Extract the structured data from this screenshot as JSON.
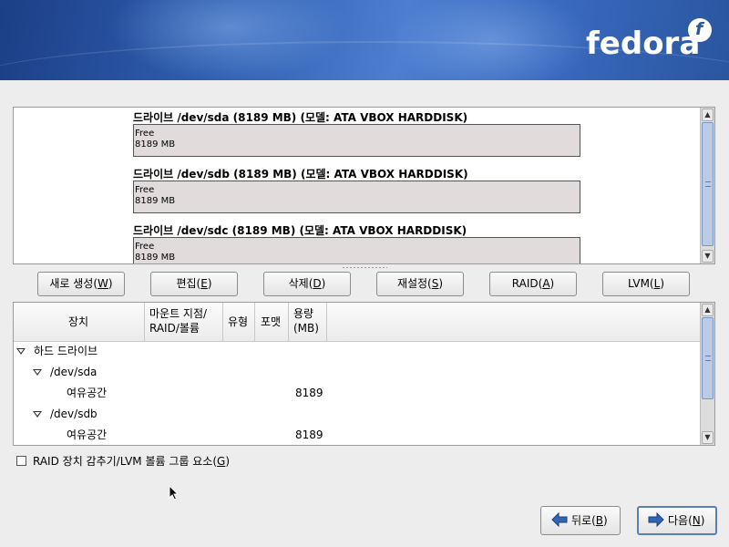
{
  "brand": {
    "name": "fedora",
    "mark": "f",
    "trademark": "™"
  },
  "drives": [
    {
      "title": "드라이브 /dev/sda (8189 MB) (모델: ATA VBOX HARDDISK)",
      "segment_label": "Free",
      "segment_size": "8189 MB"
    },
    {
      "title": "드라이브 /dev/sdb (8189 MB) (모델: ATA VBOX HARDDISK)",
      "segment_label": "Free",
      "segment_size": "8189 MB"
    },
    {
      "title": "드라이브 /dev/sdc (8189 MB) (모델: ATA VBOX HARDDISK)",
      "segment_label": "Free",
      "segment_size": "8189 MB"
    }
  ],
  "actions": {
    "new": {
      "text": "새로 생성(",
      "key": "W",
      "end": ")"
    },
    "edit": {
      "text": "편집(",
      "key": "E",
      "end": ")"
    },
    "delete": {
      "text": "삭제(",
      "key": "D",
      "end": ")"
    },
    "reset": {
      "text": "재설정(",
      "key": "S",
      "end": ")"
    },
    "raid": {
      "text": "RAID(",
      "key": "A",
      "end": ")"
    },
    "lvm": {
      "text": "LVM(",
      "key": "L",
      "end": ")"
    }
  },
  "table": {
    "columns": {
      "device": "장치",
      "mount_line1": "마운트 지점/",
      "mount_line2": "RAID/볼륨",
      "type": "유형",
      "format": "포맷",
      "size_line1": "용량",
      "size_line2": "(MB)"
    },
    "rows": [
      {
        "label": "하드 드라이브",
        "size": ""
      },
      {
        "label": "/dev/sda",
        "size": ""
      },
      {
        "label": "여유공간",
        "size": "8189"
      },
      {
        "label": "/dev/sdb",
        "size": ""
      },
      {
        "label": "여유공간",
        "size": "8189"
      }
    ]
  },
  "hide_option": {
    "text": "RAID 장치 감추기/LVM 볼륨 그룹 요소(",
    "key": "G",
    "end": ")",
    "checked": false
  },
  "nav": {
    "back": {
      "text": "뒤로(",
      "key": "B",
      "end": ")"
    },
    "next": {
      "text": "다음(",
      "key": "N",
      "end": ")"
    }
  },
  "colors": {
    "accent": "#2a559f",
    "free_segment": "#e2dbdb",
    "arrow": "#2f66b8"
  }
}
